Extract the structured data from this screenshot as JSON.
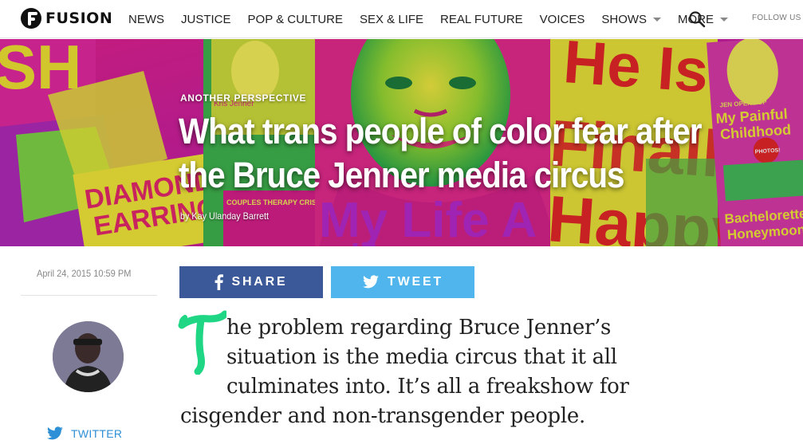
{
  "brand": {
    "name": "FUSION"
  },
  "nav": {
    "items": [
      {
        "label": "NEWS",
        "has_caret": false
      },
      {
        "label": "JUSTICE",
        "has_caret": false
      },
      {
        "label": "POP & CULTURE",
        "has_caret": false
      },
      {
        "label": "SEX & LIFE",
        "has_caret": false
      },
      {
        "label": "REAL FUTURE",
        "has_caret": false
      },
      {
        "label": "VOICES",
        "has_caret": false
      },
      {
        "label": "SHOWS",
        "has_caret": true
      },
      {
        "label": "MORE",
        "has_caret": true
      }
    ],
    "search_icon": "search-icon",
    "follow_label": "FOLLOW US"
  },
  "hero": {
    "kicker": "ANOTHER PERSPECTIVE",
    "title": "What trans people of color fear after the Bruce Jenner media circus",
    "byline": "by Kay Ulanday Barrett",
    "background_colors": [
      "#d6229a",
      "#e8e020",
      "#3ab54a",
      "#e33a2a",
      "#b12ad0"
    ],
    "collage_text": {
      "sh": "SH",
      "diamond": "DIAMOND",
      "earrings": "EARRINGS",
      "he_is": "He Is",
      "finally": "Finall",
      "happy": "Happy",
      "my_life": "My Life A",
      "dots": "...",
      "jen_opens_up": "JEN OPENS UP",
      "my_painful": "My Painful",
      "childhood": "Childhood",
      "photos": "PHOTOS!",
      "bachelorette": "Bachelorette",
      "honeymoon": "Honeymoon",
      "couples": "COUPLES THERAPY CRISIS",
      "kris": "Kris Jenner"
    }
  },
  "article": {
    "date": "April 24, 2015 10:59 PM",
    "share_label": "SHARE",
    "tweet_label": "TWEET",
    "author_twitter_label": "TWITTER",
    "dropcap_letter": "T",
    "dropcap_color": "#1ed684",
    "lead_lines": [
      "he problem regarding Bruce Jenner’s",
      "situation is the media circus that it all",
      "culminates into. It’s all a freakshow for",
      "cisgender and non-transgender people."
    ]
  },
  "colors": {
    "facebook": "#3b5998",
    "twitter": "#4fb5ec",
    "twitter_link": "#2d8fd5"
  }
}
